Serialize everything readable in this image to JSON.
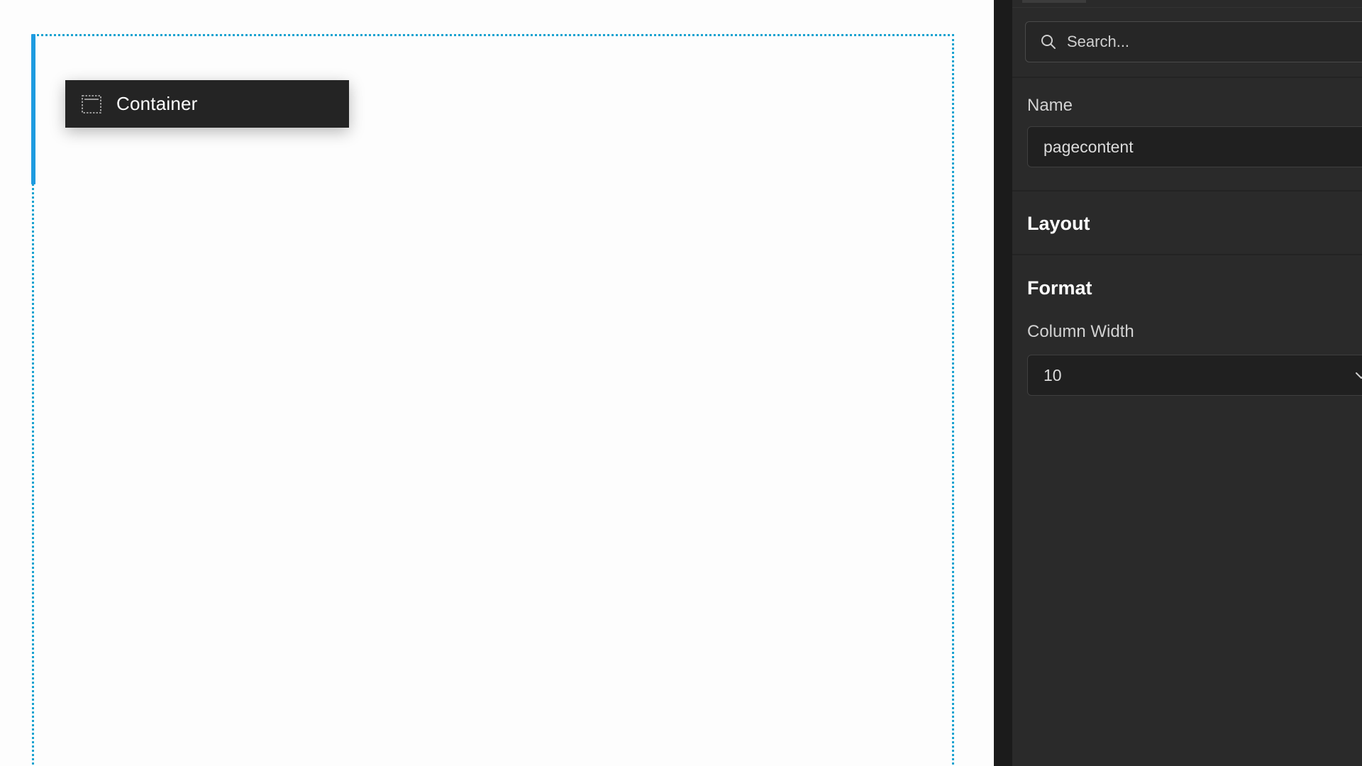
{
  "canvas": {
    "drag_chip": {
      "label": "Container",
      "icon": "container-icon"
    }
  },
  "sidebar": {
    "search": {
      "placeholder": "Search...",
      "icon": "search-icon"
    },
    "name": {
      "label": "Name",
      "value": "pagecontent"
    },
    "layout": {
      "title": "Layout"
    },
    "format": {
      "title": "Format",
      "column_width": {
        "label": "Column Width",
        "value": "10",
        "icon": "chevron-down-icon"
      }
    }
  },
  "colors": {
    "selection_accent": "#1e9be0",
    "outline_dotted": "#1aa3d1",
    "panel_bg": "#2a2a2a",
    "chip_bg": "#242424"
  }
}
